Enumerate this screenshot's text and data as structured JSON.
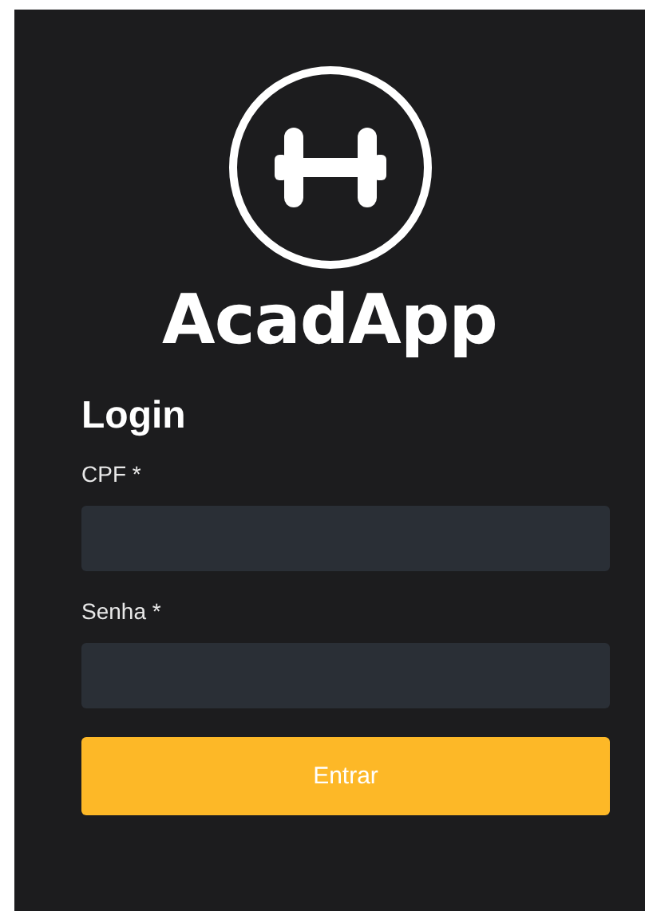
{
  "logo": {
    "name": "AcadApp"
  },
  "form": {
    "title": "Login",
    "fields": [
      {
        "label": "CPF *"
      },
      {
        "label": "Senha *"
      }
    ],
    "submit": "Entrar"
  }
}
